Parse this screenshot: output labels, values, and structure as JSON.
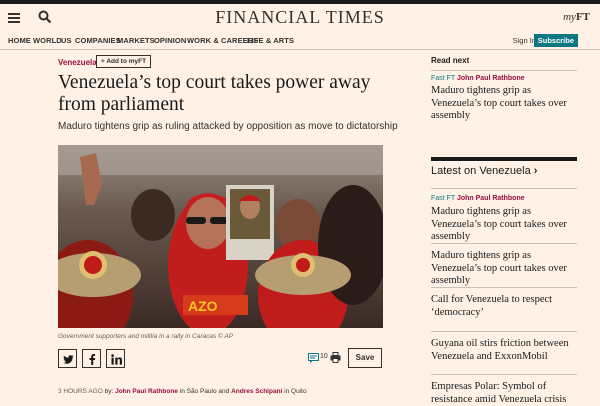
{
  "masthead": {
    "title": "FINANCIAL TIMES",
    "myft_prefix": "my",
    "myft_suffix": "FT"
  },
  "nav": {
    "items": [
      "HOME",
      "WORLD",
      "US",
      "COMPANIES",
      "MARKETS",
      "OPINION",
      "WORK & CAREERS",
      "LIFE & ARTS"
    ],
    "signin": "Sign In",
    "subscribe": "Subscribe"
  },
  "article": {
    "topic": "Venezuela",
    "add_to_myft": "+ Add to myFT",
    "headline": "Venezuela’s top court takes power away from parliament",
    "standfirst": "Maduro tightens grip as ruling attacked by opposition as move to dictatorship",
    "caption": "Government supporters and militia in a rally in Caracas © AP",
    "comment_count": "10",
    "save_label": "Save",
    "byline": {
      "time": "3 hours ago",
      "by": " by: ",
      "author1": "John Paul Rathbone",
      "mid": " in São Paulo and ",
      "author2": "Andres Schipani",
      "end": " in Quito"
    }
  },
  "read_next": {
    "heading": "Read next",
    "tag": "Fast FT",
    "author": "John Paul Rathbone",
    "title": "Maduro tightens grip as Venezuela’s top court takes over assembly"
  },
  "latest": {
    "heading": "Latest on Venezuela",
    "items": [
      {
        "tag": "Fast FT",
        "author": "John Paul Rathbone",
        "title": "Maduro tightens grip as Venezuela’s top court takes over assembly"
      },
      {
        "title": "Maduro tightens grip as Venezuela’s top court takes over assembly"
      },
      {
        "title": "Call for Venezuela to respect ‘democracy’"
      },
      {
        "title": "Guyana oil stirs friction between Venezuela and ExxonMobil"
      },
      {
        "title": "Empresas Polar: Symbol of resistance amid Venezuela crisis"
      }
    ]
  },
  "colors": {
    "background": "#fff1e5",
    "claret": "#990f3d",
    "teal": "#0d7680"
  }
}
